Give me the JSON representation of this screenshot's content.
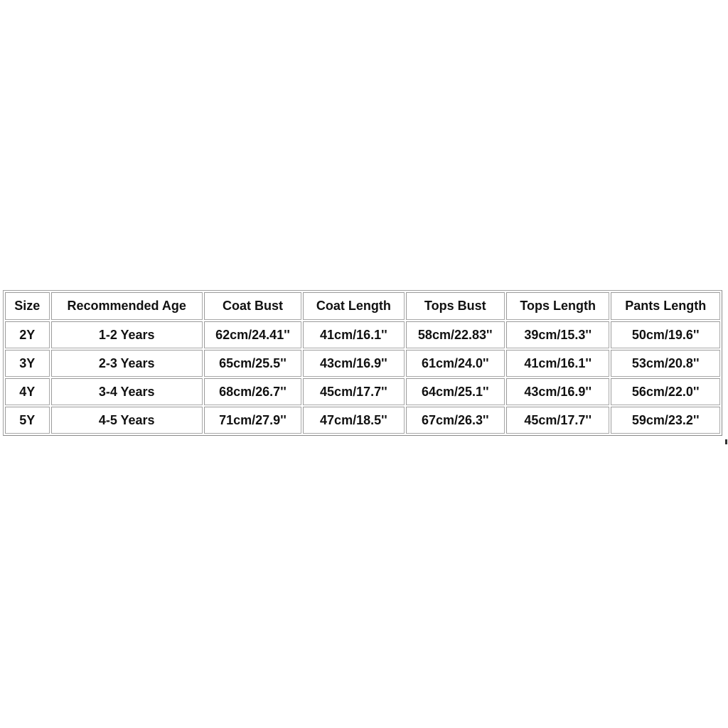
{
  "size_chart": {
    "headers": [
      "Size",
      "Recommended Age",
      "Coat Bust",
      "Coat Length",
      "Tops Bust",
      "Tops Length",
      "Pants Length"
    ],
    "rows": [
      [
        "2Y",
        "1-2 Years",
        "62cm/24.41''",
        "41cm/16.1''",
        "58cm/22.83''",
        "39cm/15.3''",
        "50cm/19.6''"
      ],
      [
        "3Y",
        "2-3 Years",
        "65cm/25.5''",
        "43cm/16.9''",
        "61cm/24.0''",
        "41cm/16.1''",
        "53cm/20.8''"
      ],
      [
        "4Y",
        "3-4 Years",
        "68cm/26.7''",
        "45cm/17.7''",
        "64cm/25.1''",
        "43cm/16.9''",
        "56cm/22.0''"
      ],
      [
        "5Y",
        "4-5 Years",
        "71cm/27.9''",
        "47cm/18.5''",
        "67cm/26.3''",
        "45cm/17.7''",
        "59cm/23.2''"
      ]
    ]
  }
}
